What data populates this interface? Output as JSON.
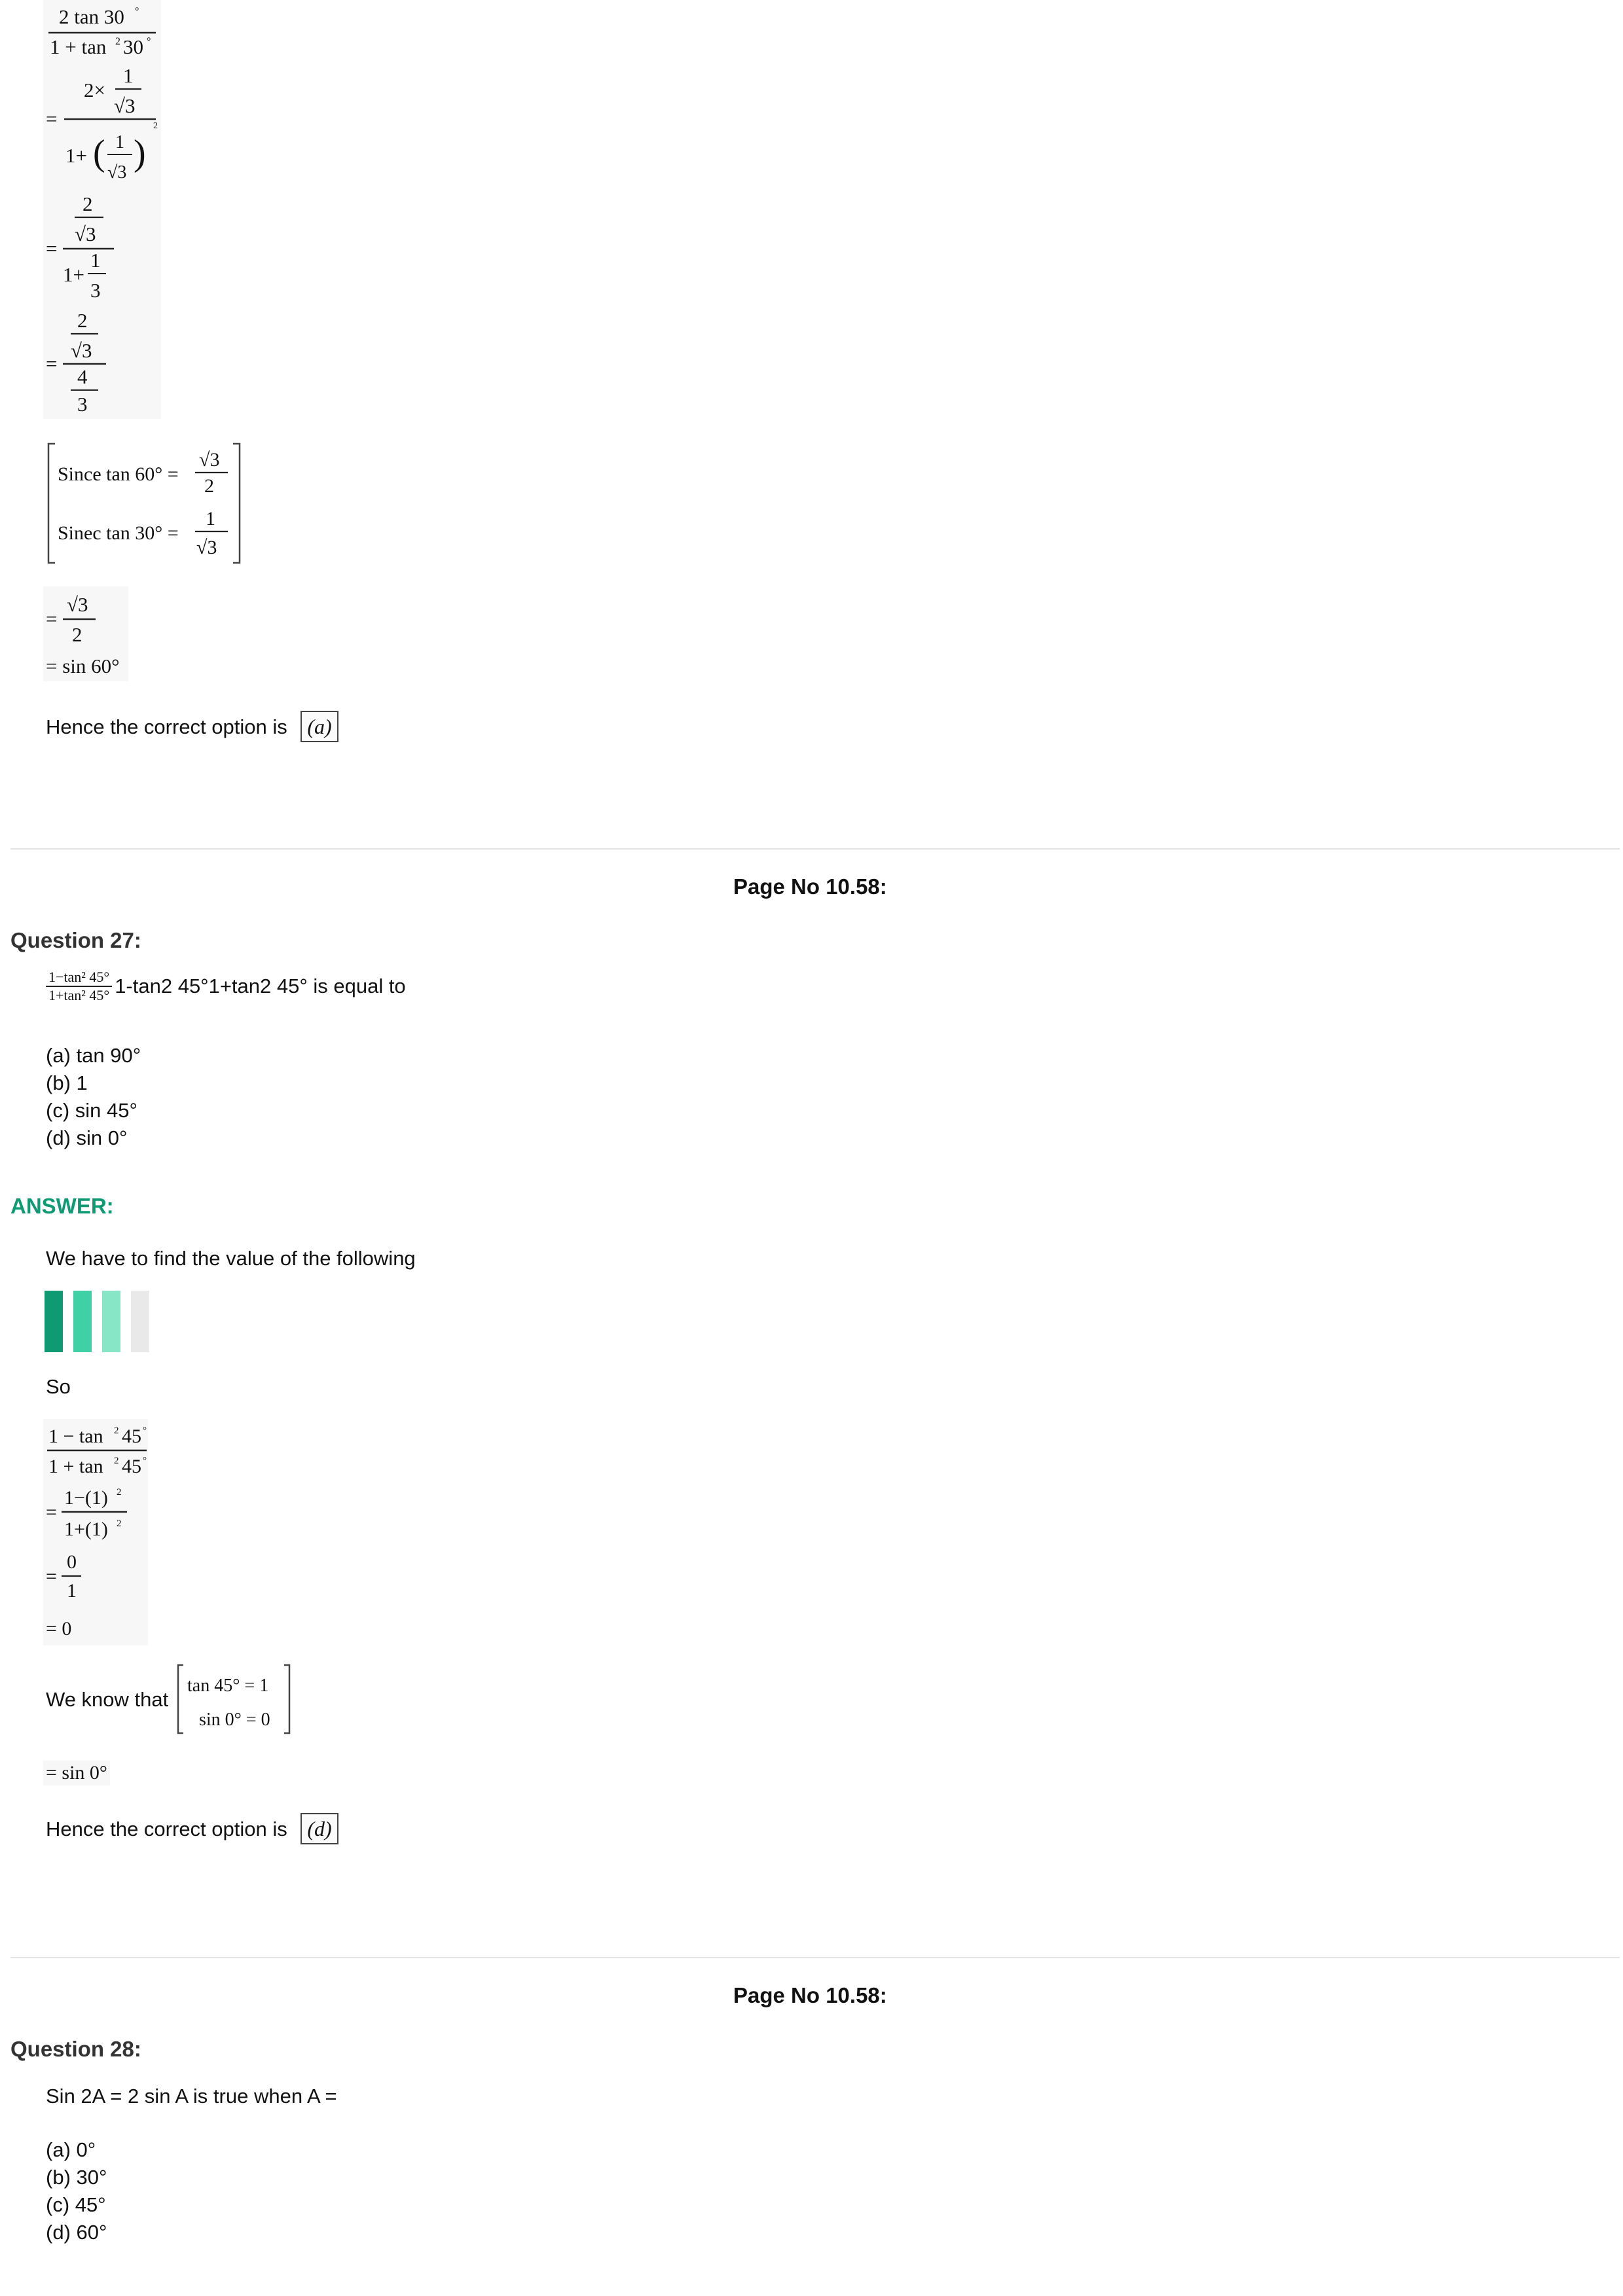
{
  "section1": {
    "math_block_1": {
      "line1_num": "2 tan 30°",
      "line1_den": "1 + tan² 30°",
      "line2": "= 2×(1/√3) / (1+(1/√3)²)",
      "line3": "= (2/√3) / (1+1/3)",
      "line4": "= (2/√3) / (4/3)"
    },
    "since_box": {
      "line1_label": "Since  tan 60° =",
      "line1_num": "√3",
      "line1_den": "2",
      "line2_label": "Sinec  tan 30° =",
      "line2_num": "1",
      "line2_den": "√3"
    },
    "math_block_2": {
      "line1_num": "√3",
      "line1_den": "2",
      "line2": "= sin 60°"
    },
    "conclusion": "Hence the correct option is",
    "option": "(a)"
  },
  "page_label_1": "Page No 10.58:",
  "question27": {
    "title": "Question 27:",
    "expr_num": "1−tan² 45°",
    "expr_den": "1+tan² 45°",
    "text": "1-tan2 45°1+tan2 45° is equal to",
    "options": [
      "(a) tan 90°",
      "(b) 1",
      "(c) sin 45°",
      "(d) sin 0°"
    ],
    "answer_label": "ANSWER:",
    "intro": "We have to find the value of the following",
    "so": "So",
    "math": {
      "l1_num": "1 − tan² 45°",
      "l1_den": "1 + tan² 45°",
      "l2_num": "1−(1)²",
      "l2_den": "1+(1)²",
      "l3_num": "0",
      "l3_den": "1",
      "l4": "= 0"
    },
    "we_know": "We know that",
    "know_box": {
      "line1": "tan 45° = 1",
      "line2": "sin 0° = 0"
    },
    "result": "= sin 0°",
    "conclusion": "Hence the correct option is",
    "option": "(d)",
    "colors": {
      "bar1": "#0e9a73",
      "bar2": "#3fd0a6",
      "bar3": "#86e6c6",
      "bar4": "#e9e9e9"
    }
  },
  "page_label_2": "Page No 10.58:",
  "question28": {
    "title": "Question 28:",
    "text": "Sin 2A = 2 sin A is true when A =",
    "options": [
      "(a) 0°",
      "(b) 30°",
      "(c) 45°",
      "(d) 60°"
    ]
  }
}
